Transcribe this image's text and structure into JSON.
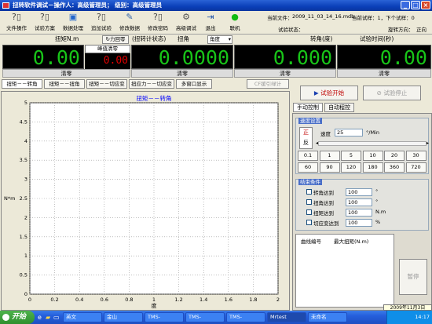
{
  "window": {
    "title": "扭转软件调试－操作人：高级管理员；  级别：高级管理员"
  },
  "toolbar": {
    "items": [
      {
        "label": "文件操作",
        "icon": "file-icon"
      },
      {
        "label": "试验方案",
        "icon": "plan-icon"
      },
      {
        "label": "数据处理",
        "icon": "data-icon"
      },
      {
        "label": "追加试验",
        "icon": "add-test-icon"
      },
      {
        "label": "修改数据",
        "icon": "edit-data-icon"
      },
      {
        "label": "修改密码",
        "icon": "password-icon"
      },
      {
        "label": "高级调试",
        "icon": "debug-icon"
      },
      {
        "label": "退出",
        "icon": "exit-icon"
      },
      {
        "label": "联机",
        "icon": "online-icon"
      }
    ]
  },
  "info": {
    "current_file_label": "当前文件：",
    "current_file": "2009_11_03_14_16.mdb",
    "test_count_label": "当前试样：1，下个试样：0",
    "test_status_label": "试验状态：",
    "rotation_label": "旋转方向：",
    "rotation_value": "正向"
  },
  "readouts": {
    "torque_header": "扭矩N.m",
    "return_zero": "力回零",
    "peak_clear": "峰值清零",
    "peak_value": "0.00",
    "torque_value": "0.00",
    "torque_zero": "清零",
    "meter_status_header": "(扭转计状态)",
    "angle_header": "扭角",
    "angle_select": "角度",
    "angle_value": "0.0000",
    "angle_zero": "清零",
    "rotation_header": "转角(度)",
    "rotation_value": "0.000",
    "rotation_zero": "清零",
    "time_header": "试验时间(秒)",
    "time_value": "0.00",
    "time_zero": "清零"
  },
  "chart_tabs": [
    "扭矩－－转角",
    "扭矩－－扭角",
    "扭矩－－切应变",
    "扭应力－－切应变",
    "多窗口显示"
  ],
  "chart_tab_disabled": "CF援引绿计",
  "chart_data": {
    "type": "line",
    "title": "扭矩－－转角",
    "xlabel": "度",
    "ylabel": "N*m",
    "xlim": [
      0,
      2
    ],
    "ylim": [
      0,
      5
    ],
    "x_ticks": [
      "0",
      "0.2",
      "0.4",
      "0.6",
      "0.8",
      "1",
      "1.2",
      "1.4",
      "1.6",
      "1.8",
      "2"
    ],
    "y_ticks": [
      "0",
      "0.5",
      "1",
      "1.5",
      "2",
      "2.5",
      "3",
      "3.5",
      "4",
      "4.5",
      "5"
    ],
    "grid": true,
    "series": []
  },
  "right": {
    "start_button": "试验开始",
    "stop_button": "试验停止",
    "tabs": [
      "手动控制",
      "自动程控"
    ],
    "speed_group": "速度设置",
    "direction_fwd": "正",
    "direction_rev": "反",
    "speed_label": "速度",
    "speed_value": "25",
    "speed_unit": "°/Min",
    "speed_buttons": [
      "0.1",
      "1",
      "5",
      "10",
      "20",
      "30",
      "60",
      "90",
      "120",
      "180",
      "360",
      "720"
    ],
    "end_group": "结束条件",
    "end_conditions": [
      {
        "label": "转角达到",
        "value": "100",
        "unit": "°"
      },
      {
        "label": "扭角达到",
        "value": "100",
        "unit": "°"
      },
      {
        "label": "扭矩达到",
        "value": "100",
        "unit": "N.m"
      },
      {
        "label": "切应变达到",
        "value": "100",
        "unit": "%"
      }
    ],
    "curve_no_label": "曲线编号",
    "max_torque_label": "最大扭矩(N.m)",
    "pause_button": "暂停"
  },
  "taskbar": {
    "start": "开始",
    "tasks": [
      "英文",
      "金山",
      "TMS-",
      "TMS-",
      "TMS-",
      "Mrtest",
      "未命名"
    ],
    "date_tooltip": "2009年11月3日",
    "clock": "14:17"
  },
  "colors": {
    "lcd_bg": "#000000",
    "lcd_fg": "#18c418",
    "peak_fg": "#e00000",
    "title_bar": "#0a3fb8",
    "chart_title": "#0000ff"
  }
}
